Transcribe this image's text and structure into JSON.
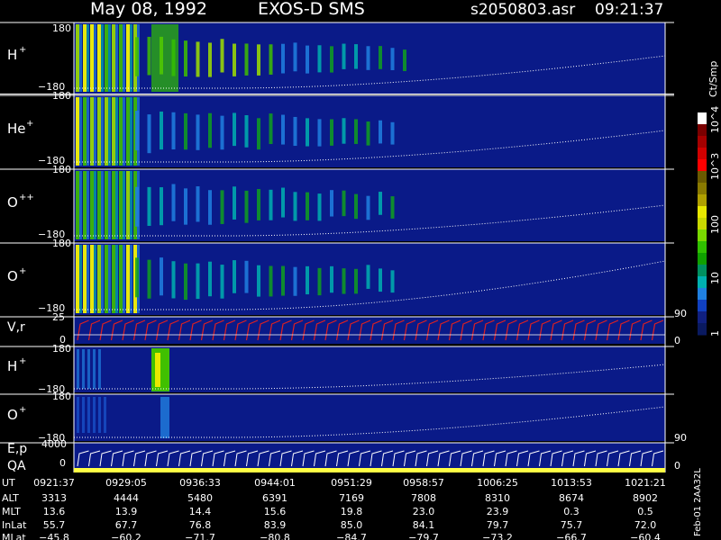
{
  "header": {
    "date": "May 08, 1992",
    "instrument": "EXOS-D SMS",
    "file": "s2050803.asr",
    "time": "09:21:37"
  },
  "panels": [
    {
      "label": "H",
      "sup": "+",
      "top_tick": "180",
      "bottom_tick": "−180"
    },
    {
      "label": "He",
      "sup": "+",
      "top_tick": "180",
      "bottom_tick": "−180"
    },
    {
      "label": "O",
      "sup": "++",
      "top_tick": "180",
      "bottom_tick": "−180"
    },
    {
      "label": "O",
      "sup": "+",
      "top_tick": "180",
      "bottom_tick": "−180"
    }
  ],
  "vr_panel": {
    "label": "V,r",
    "left_top": "25",
    "left_mid": "0",
    "right_top": "90",
    "right_bottom": "0"
  },
  "h_panel2": {
    "label": "H",
    "sup": "+",
    "top_tick": "180",
    "bottom_tick": "−180"
  },
  "o_panel2": {
    "label": "O",
    "sup": "+",
    "top_tick": "180",
    "bottom_tick": "−180",
    "right_tick": "90"
  },
  "ep_panel": {
    "label1": "E,p",
    "label2": "QA",
    "left_top": "4000",
    "left_mid": "0",
    "right_tick": "0"
  },
  "colorbar": {
    "unit": "Ct/Smp",
    "tick_labels": [
      "10^4",
      "10^3",
      "100",
      "10",
      "1"
    ],
    "colors": [
      "#ffffff",
      "#7a0000",
      "#a50000",
      "#d00000",
      "#ff0000",
      "#6a5a00",
      "#8a7a00",
      "#b0a000",
      "#e8e800",
      "#c8d800",
      "#7ad800",
      "#30c000",
      "#10a000",
      "#009060",
      "#00b0b0",
      "#2080e0",
      "#1040c0",
      "#102080",
      "#0a1a60"
    ]
  },
  "side_text": "Feb-01  2AA32L",
  "chart_data": {
    "type": "heatmap",
    "title": "May 08, 1992   EXOS-D SMS   s2050803.asr  09:21:37",
    "rows": [
      "UT",
      "ALT",
      "MLT",
      "InLat",
      "MLat"
    ],
    "columns": [
      {
        "UT": "0921:37",
        "ALT": "3313",
        "MLT": "13.6",
        "InLat": "55.7",
        "MLat": "−45.8"
      },
      {
        "UT": "0929:05",
        "ALT": "4444",
        "MLT": "13.9",
        "InLat": "67.7",
        "MLat": "−60.2"
      },
      {
        "UT": "0936:33",
        "ALT": "5480",
        "MLT": "14.4",
        "InLat": "76.8",
        "MLat": "−71.7"
      },
      {
        "UT": "0944:01",
        "ALT": "6391",
        "MLT": "15.6",
        "InLat": "83.9",
        "MLat": "−80.8"
      },
      {
        "UT": "0951:29",
        "ALT": "7169",
        "MLT": "19.8",
        "InLat": "85.0",
        "MLat": "−84.7"
      },
      {
        "UT": "0958:57",
        "ALT": "7808",
        "MLT": "23.0",
        "InLat": "84.1",
        "MLat": "−79.7"
      },
      {
        "UT": "1006:25",
        "ALT": "8310",
        "MLT": "23.9",
        "InLat": "79.7",
        "MLat": "−73.2"
      },
      {
        "UT": "1013:53",
        "ALT": "8674",
        "MLT": "0.3",
        "InLat": "75.7",
        "MLat": "−66.7"
      },
      {
        "UT": "1021:21",
        "ALT": "8902",
        "MLT": "0.5",
        "InLat": "72.0",
        "MLat": "−60.4"
      }
    ]
  }
}
